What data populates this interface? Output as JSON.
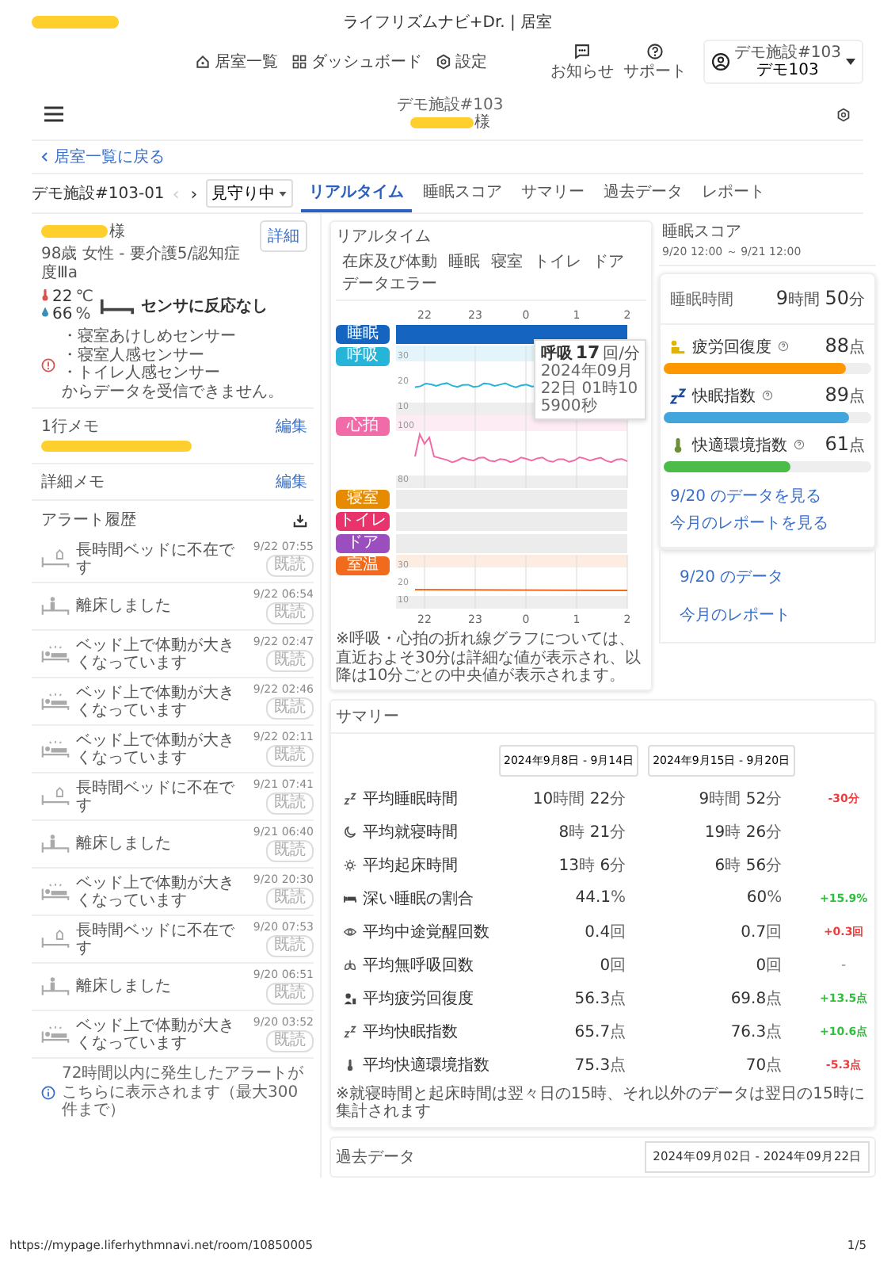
{
  "app_title": "ライフリズムナビ+Dr. | 居室",
  "nav": [
    {
      "label": "居室一覧",
      "kind": "home"
    },
    {
      "label": "ダッシュボード",
      "kind": "grid"
    },
    {
      "label": "設定",
      "kind": "gear"
    }
  ],
  "header_actions": [
    {
      "label": "お知らせ",
      "kind": "chat"
    },
    {
      "label": "サポート",
      "kind": "help"
    }
  ],
  "user": {
    "facility": "デモ施設#103",
    "name": "デモ103"
  },
  "subbar": {
    "facility": "デモ施設#103",
    "honorific": "様"
  },
  "back_link": "居室一覧に戻る",
  "room": {
    "name": "デモ施設#103-01",
    "prev": {
      "glyph": "‹",
      "disabled": true
    },
    "next": {
      "glyph": "›",
      "disabled": false
    },
    "status": "見守り中"
  },
  "tabs": [
    {
      "label": "リアルタイム",
      "selected": true
    },
    {
      "label": "睡眠スコア",
      "selected": false
    },
    {
      "label": "サマリー",
      "selected": false
    },
    {
      "label": "過去データ",
      "selected": false
    },
    {
      "label": "レポート",
      "selected": false
    }
  ],
  "patient": {
    "honorific": "様",
    "info": "98歳 女性 - 要介護5/認知症度Ⅲa",
    "detail_button": "詳細",
    "temperature": "22",
    "temperature_unit": "℃",
    "humidity": "66",
    "humidity_unit": "%",
    "sensor_status": "センサに反応なし",
    "warning_lines": [
      "・寝室あけしめセンサー",
      "・寝室人感センサー",
      "・トイレ人感センサー",
      "からデータを受信できません。"
    ]
  },
  "memos": [
    {
      "title": "1行メモ",
      "edit": "編集",
      "redacted": true
    },
    {
      "title": "詳細メモ",
      "edit": "編集",
      "redacted": false
    }
  ],
  "alerts_title": "アラート履歴",
  "alerts": [
    {
      "kind": "absent",
      "text": "長時間ベッドに不在です",
      "time": "9/22 07:55",
      "badge": "既読"
    },
    {
      "kind": "getup",
      "text": "離床しました",
      "time": "9/22 06:54",
      "badge": "既読"
    },
    {
      "kind": "movement",
      "text": "ベッド上で体動が大きくなっています",
      "time": "9/22 02:47",
      "badge": "既読"
    },
    {
      "kind": "movement",
      "text": "ベッド上で体動が大きくなっています",
      "time": "9/22 02:46",
      "badge": "既読"
    },
    {
      "kind": "movement",
      "text": "ベッド上で体動が大きくなっています",
      "time": "9/22 02:11",
      "badge": "既読"
    },
    {
      "kind": "absent",
      "text": "長時間ベッドに不在です",
      "time": "9/21 07:41",
      "badge": "既読"
    },
    {
      "kind": "getup",
      "text": "離床しました",
      "time": "9/21 06:40",
      "badge": "既読"
    },
    {
      "kind": "movement",
      "text": "ベッド上で体動が大きくなっています",
      "time": "9/20 20:30",
      "badge": "既読"
    },
    {
      "kind": "absent",
      "text": "長時間ベッドに不在です",
      "time": "9/20 07:53",
      "badge": "既読"
    },
    {
      "kind": "getup",
      "text": "離床しました",
      "time": "9/20 06:51",
      "badge": "既読"
    },
    {
      "kind": "movement",
      "text": "ベッド上で体動が大きくなっています",
      "time": "9/20 03:52",
      "badge": "既読"
    }
  ],
  "alerts_note": "72時間以内に発生したアラートがこちらに表示されます（最大300件まで）",
  "realtime": {
    "title": "リアルタイム",
    "legend": [
      "在床及び体動",
      "睡眠",
      "寝室",
      "トイレ",
      "ドア",
      "データエラー"
    ],
    "top_ticks": [
      "22",
      "23",
      "0",
      "1",
      "2"
    ],
    "bottom_ticks": [
      "22",
      "23",
      "0",
      "1",
      "2"
    ],
    "lanes": [
      {
        "label": "睡眠",
        "kind": "band",
        "color": "#1565c0"
      },
      {
        "label": "呼吸",
        "kind": "line",
        "color": "#26b5d9",
        "ticks": [
          "30",
          "20",
          "10"
        ]
      },
      {
        "label": "心拍",
        "kind": "line",
        "color": "#f06ba8",
        "ticks": [
          "100",
          "80"
        ]
      },
      {
        "label": "寝室",
        "kind": "empty",
        "color": "#e68a00"
      },
      {
        "label": "トイレ",
        "kind": "empty",
        "color": "#e8336d"
      },
      {
        "label": "ドア",
        "kind": "empty",
        "color": "#9b4fbf"
      },
      {
        "label": "室温",
        "kind": "line",
        "color": "#f26b1d",
        "ticks": [
          "30",
          "20",
          "10"
        ]
      }
    ],
    "tooltip": {
      "title": "呼吸",
      "value": "17",
      "unit": "回/分",
      "lines": [
        "2024年09月",
        "22日 01時10",
        "5900秒"
      ]
    },
    "note": "※呼吸・心拍の折れ線グラフについては、直近およそ30分は詳細な値が表示され、以降は10分ごとの中央値が表示されます。"
  },
  "sleep_score": {
    "title": "睡眠スコア",
    "period": "9/20 12:00 ～ 9/21 12:00",
    "duration_label": "睡眠時間",
    "hours": "9",
    "hours_unit": "時間",
    "minutes": "50",
    "minutes_unit": "分",
    "scores": [
      {
        "kind": "recovery",
        "label": "疲労回復度",
        "value": "88",
        "unit": "点",
        "level": 0.88,
        "color": "#ff9800"
      },
      {
        "kind": "sleep",
        "label": "快眠指数",
        "value": "89",
        "unit": "点",
        "level": 0.89,
        "color": "#42a5dc"
      },
      {
        "kind": "environment",
        "label": "快適環境指数",
        "value": "61",
        "unit": "点",
        "level": 0.61,
        "color": "#4cbb47"
      }
    ],
    "links": [
      "9/20 のデータを見る",
      "今月のレポートを見る"
    ],
    "footer_links": [
      "9/20 のデータ",
      "今月のレポート"
    ]
  },
  "summary": {
    "title": "サマリー",
    "periods": [
      "2024年9月8日 - 9月14日",
      "2024年9月15日 - 9月20日"
    ],
    "rows": [
      {
        "label": "平均睡眠時間",
        "v1": [
          [
            "10",
            "時間"
          ],
          [
            "22",
            "分"
          ]
        ],
        "v2": [
          [
            "9",
            "時間"
          ],
          [
            "52",
            "分"
          ]
        ],
        "diff": "-30分",
        "color": "#f03c3c"
      },
      {
        "label": "平均就寝時間",
        "v1": [
          [
            "8",
            "時"
          ],
          [
            "21",
            "分"
          ]
        ],
        "v2": [
          [
            "19",
            "時"
          ],
          [
            "26",
            "分"
          ]
        ]
      },
      {
        "label": "平均起床時間",
        "v1": [
          [
            "13",
            "時"
          ],
          [
            "6",
            "分"
          ]
        ],
        "v2": [
          [
            "6",
            "時"
          ],
          [
            "56",
            "分"
          ]
        ]
      },
      {
        "label": "深い睡眠の割合",
        "v1": [
          [
            "44.1",
            "%"
          ]
        ],
        "v2": [
          [
            "60",
            "%"
          ]
        ],
        "diff": "+15.9%",
        "color": "#2fbf3a"
      },
      {
        "label": "平均中途覚醒回数",
        "v1": [
          [
            "0.4",
            "回"
          ]
        ],
        "v2": [
          [
            "0.7",
            "回"
          ]
        ],
        "diff": "+0.3回",
        "color": "#f03c3c"
      },
      {
        "label": "平均無呼吸回数",
        "v1": [
          [
            "0",
            "回"
          ]
        ],
        "v2": [
          [
            "0",
            "回"
          ]
        ],
        "diff": "-",
        "color": "#aaaaaa"
      },
      {
        "label": "平均疲労回復度",
        "v1": [
          [
            "56.3",
            "点"
          ]
        ],
        "v2": [
          [
            "69.8",
            "点"
          ]
        ],
        "diff": "+13.5点",
        "color": "#2fbf3a"
      },
      {
        "label": "平均快眠指数",
        "v1": [
          [
            "65.7",
            "点"
          ]
        ],
        "v2": [
          [
            "76.3",
            "点"
          ]
        ],
        "diff": "+10.6点",
        "color": "#2fbf3a"
      },
      {
        "label": "平均快適環境指数",
        "v1": [
          [
            "75.3",
            "点"
          ]
        ],
        "v2": [
          [
            "70",
            "点"
          ]
        ],
        "diff": "-5.3点",
        "color": "#f03c3c"
      }
    ],
    "note": "※就寝時間と起床時間は翌々日の15時、それ以外のデータは翌日の15時に集計されます"
  },
  "past": {
    "title": "過去データ",
    "range": "2024年09月02日 - 2024年09月22日"
  },
  "footer": {
    "url": "https://mypage.liferhythmnavi.net/room/10850005",
    "page": "1/5"
  }
}
